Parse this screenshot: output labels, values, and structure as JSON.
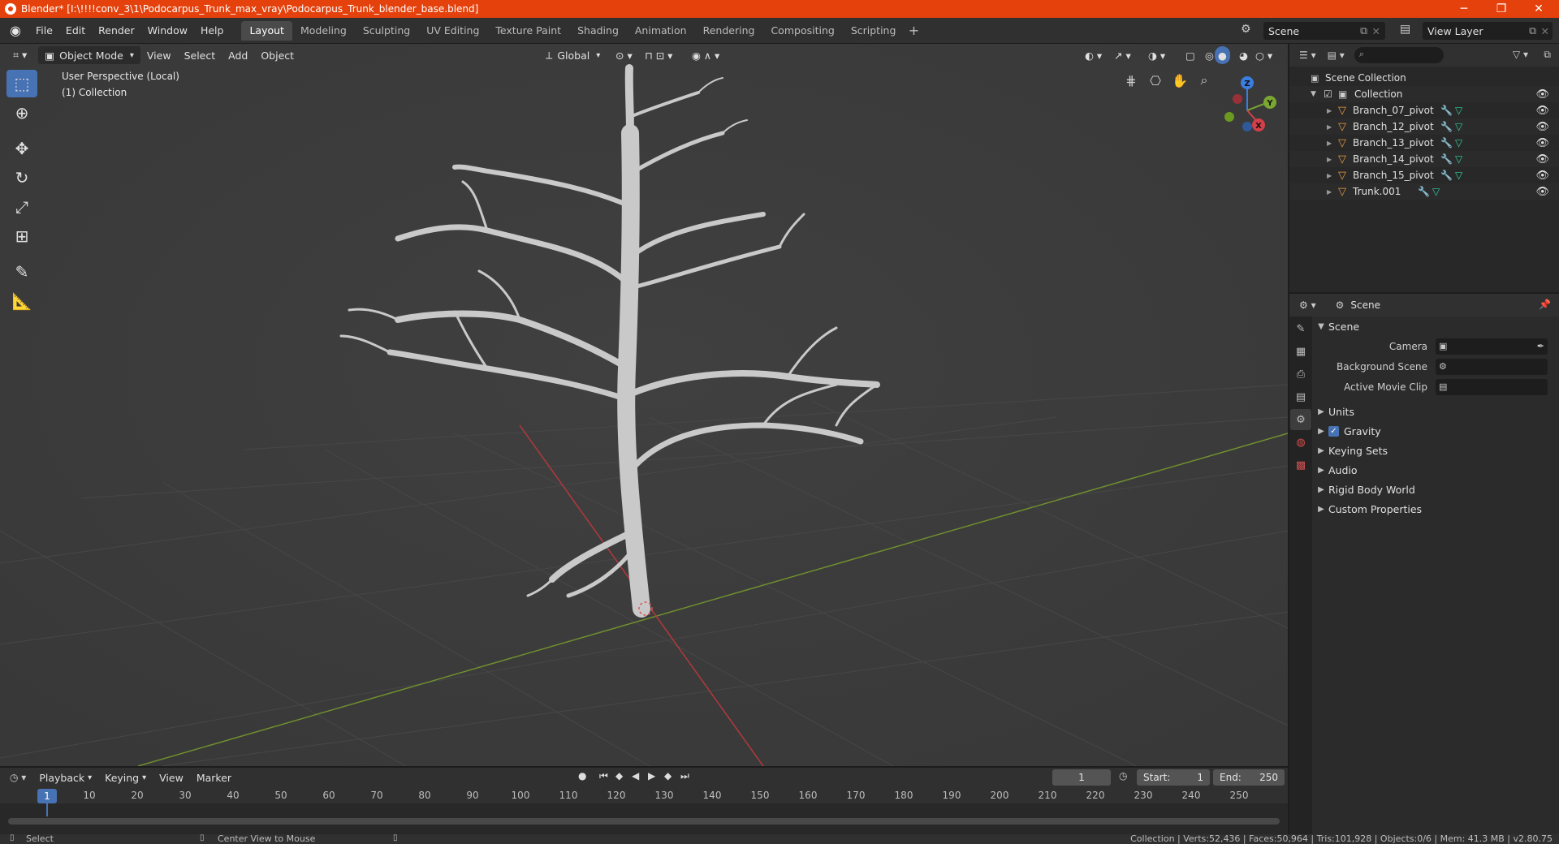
{
  "window": {
    "title": "Blender* [I:\\!!!!conv_3\\1\\Podocarpus_Trunk_max_vray\\Podocarpus_Trunk_blender_base.blend]",
    "minimize": "─",
    "maximize": "❐",
    "close": "✕"
  },
  "menubar": {
    "items": [
      "File",
      "Edit",
      "Render",
      "Window",
      "Help"
    ]
  },
  "workspaces": {
    "tabs": [
      "Layout",
      "Modeling",
      "Sculpting",
      "UV Editing",
      "Texture Paint",
      "Shading",
      "Animation",
      "Rendering",
      "Compositing",
      "Scripting"
    ],
    "add": "+"
  },
  "scene_selector": {
    "value": "Scene"
  },
  "viewlayer_selector": {
    "value": "View Layer"
  },
  "viewport": {
    "mode": "Object Mode",
    "menus": [
      "View",
      "Select",
      "Add",
      "Object"
    ],
    "orientation": "Global",
    "info_line1": "User Perspective (Local)",
    "info_line2": "(1) Collection",
    "gizmo": {
      "x": "X",
      "y": "Y",
      "z": "Z"
    }
  },
  "outliner": {
    "root": "Scene Collection",
    "collection": "Collection",
    "objects": [
      "Branch_07_pivot",
      "Branch_12_pivot",
      "Branch_13_pivot",
      "Branch_14_pivot",
      "Branch_15_pivot",
      "Trunk.001"
    ]
  },
  "properties": {
    "context": "Scene",
    "panel_title": "Scene",
    "camera_label": "Camera",
    "background_scene_label": "Background Scene",
    "active_movie_clip_label": "Active Movie Clip",
    "sections": [
      "Units",
      "Gravity",
      "Keying Sets",
      "Audio",
      "Rigid Body World",
      "Custom Properties"
    ],
    "gravity_enabled": true
  },
  "timeline": {
    "menus": [
      "Playback",
      "Keying",
      "View",
      "Marker"
    ],
    "current_frame": "1",
    "start_label": "Start:",
    "start_value": "1",
    "end_label": "End:",
    "end_value": "250",
    "ruler": [
      "10",
      "20",
      "30",
      "40",
      "50",
      "60",
      "70",
      "80",
      "90",
      "100",
      "110",
      "120",
      "130",
      "140",
      "150",
      "160",
      "170",
      "180",
      "190",
      "200",
      "210",
      "220",
      "230",
      "240",
      "250"
    ],
    "ruler_current": "1"
  },
  "statusbar": {
    "left": "Select",
    "middle": "Center View to Mouse",
    "right": "Collection | Verts:52,436 | Faces:50,964 | Tris:101,928 | Objects:0/6 | Mem: 41.3 MB | v2.80.75"
  },
  "colors": {
    "accent": "#4772b3",
    "titlebar": "#e4410c",
    "axis_x": "#d4404a",
    "axis_y": "#7aa632",
    "axis_z": "#3b7de0"
  }
}
